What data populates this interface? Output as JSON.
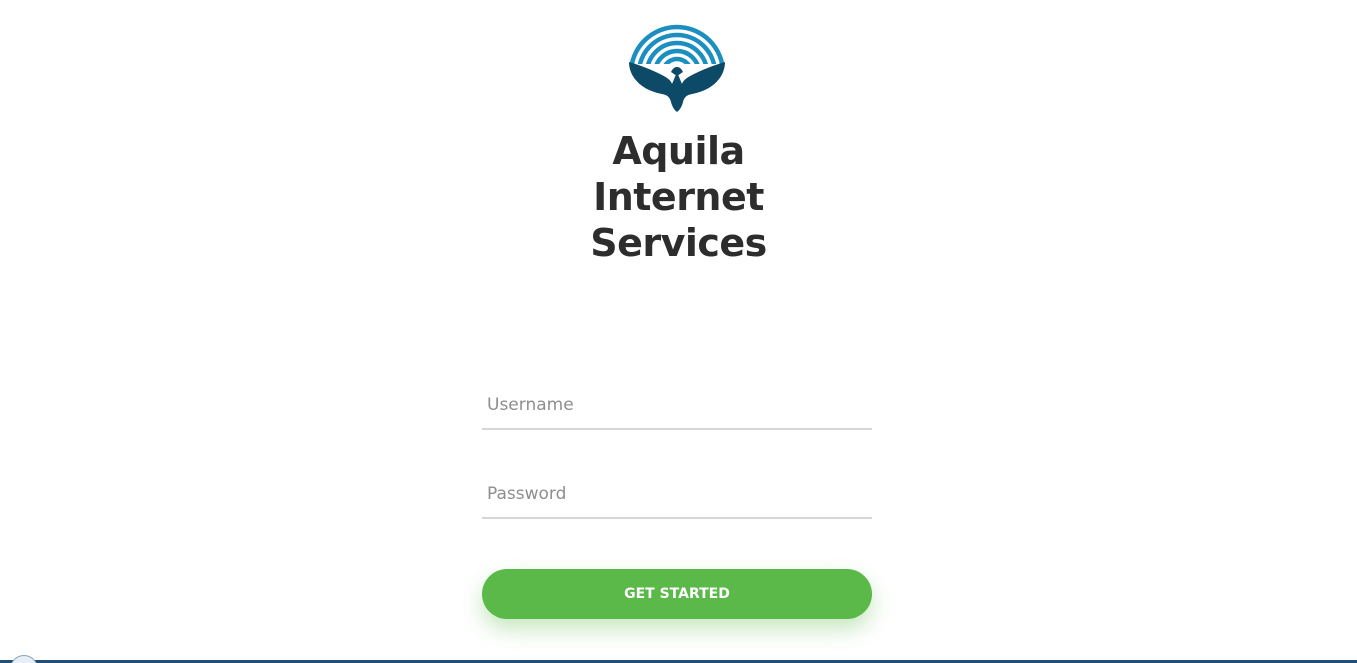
{
  "brand": {
    "logo_icon": "eagle-signal-arc-logo",
    "title": "Aquila Internet Services",
    "colors": {
      "logo_light": "#1b8fc0",
      "logo_dark": "#0d4a68"
    }
  },
  "login_form": {
    "username_placeholder": "Username",
    "password_placeholder": "Password",
    "submit_label": "GET STARTED",
    "submit_color": "#5ab948"
  }
}
